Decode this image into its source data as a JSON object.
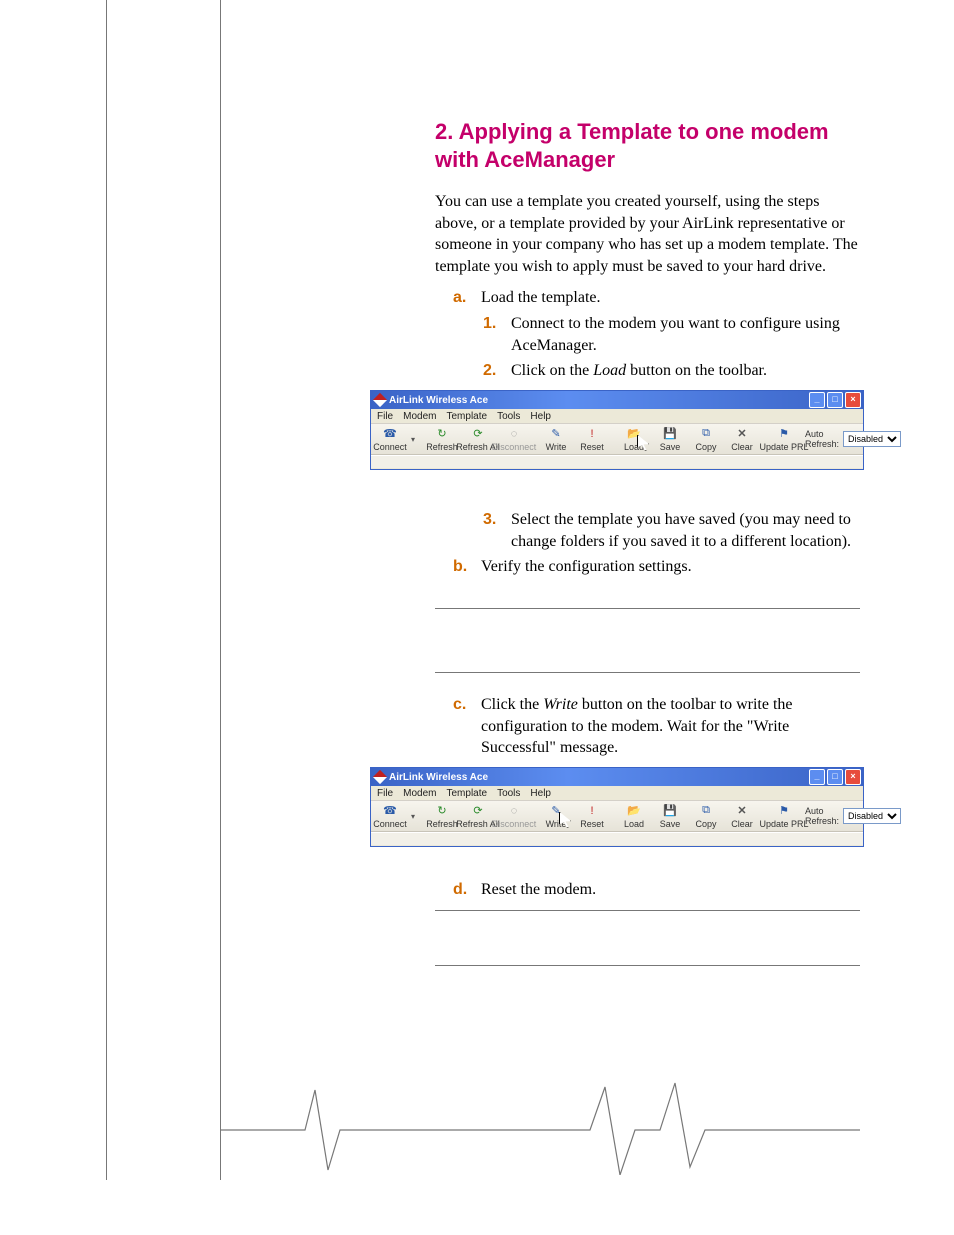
{
  "heading": "2. Applying a Template to one modem with AceManager",
  "intro": "You can use a template you created yourself, using the steps above, or a template provided by your AirLink representative or someone in your company who has set up a modem template.  The template you wish to apply must be saved to your hard drive.",
  "steps": {
    "a_marker": "a.",
    "a_text": "Load the template.",
    "a1_marker": "1.",
    "a1_text": "Connect to the modem you want to configure using AceManager.",
    "a2_marker": "2.",
    "a2_pre": "Click on the ",
    "a2_it": "Load",
    "a2_post": " button on the toolbar.",
    "a3_marker": "3.",
    "a3_text": "Select the template you have saved (you may need to change folders if you saved it to a different location).",
    "b_marker": "b.",
    "b_text": "Verify the configuration settings.",
    "c_marker": "c.",
    "c_pre": "Click the ",
    "c_it": "Write",
    "c_post": " button on the toolbar to write the configuration to the modem. Wait for the \"Write Successful\" message.",
    "d_marker": "d.",
    "d_text": "Reset the modem."
  },
  "appwin": {
    "title": "AirLink Wireless Ace",
    "menu": [
      "File",
      "Modem",
      "Template",
      "Tools",
      "Help"
    ],
    "buttons": {
      "connect": "Connect",
      "refresh": "Refresh",
      "refreshall": "Refresh All",
      "disconnect": "Disconnect",
      "write": "Write",
      "reset": "Reset",
      "load": "Load",
      "save": "Save",
      "copy": "Copy",
      "clear": "Clear",
      "updateprl": "Update PRL"
    },
    "autorefresh_label": "Auto Refresh:",
    "autorefresh_value": "Disabled",
    "win_min": "_",
    "win_max": "□",
    "win_close": "×"
  }
}
